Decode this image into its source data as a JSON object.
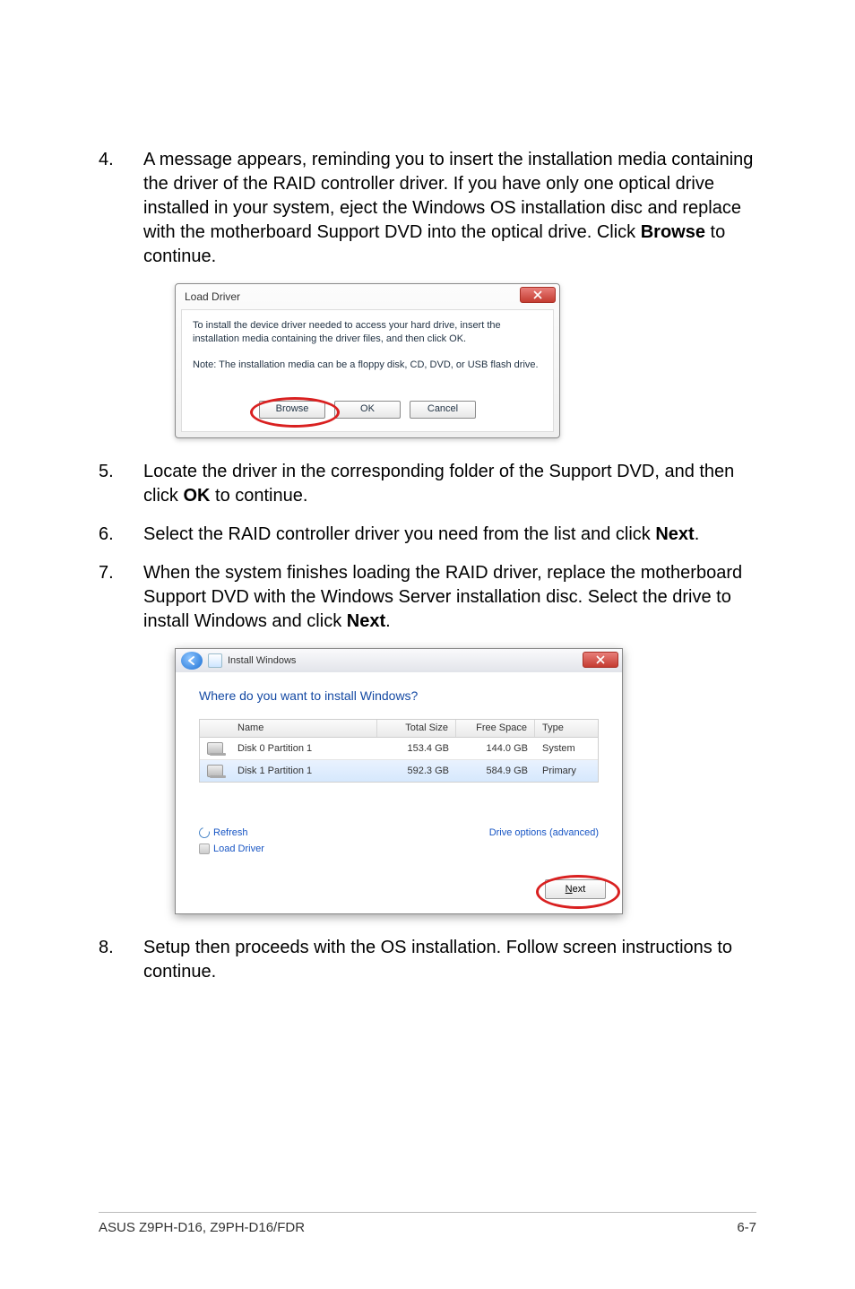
{
  "steps": {
    "s4": {
      "num": "4.",
      "text_a": "A message appears, reminding you to insert the installation media containing the driver of the RAID controller driver. If you have only one optical drive installed in your system, eject the Windows OS installation disc and replace with the motherboard Support DVD into the optical drive. Click ",
      "bold_a": "Browse",
      "text_b": " to continue."
    },
    "s5": {
      "num": "5.",
      "text_a": "Locate the driver in the corresponding folder of the Support DVD, and then click ",
      "bold_a": "OK",
      "text_b": " to continue."
    },
    "s6": {
      "num": "6.",
      "text_a": "Select the RAID controller driver you need from the list and click ",
      "bold_a": "Next",
      "text_b": "."
    },
    "s7": {
      "num": "7.",
      "text_a": "When the system finishes loading the RAID driver, replace the motherboard Support DVD with the Windows Server installation disc. Select the drive to install Windows and click ",
      "bold_a": "Next",
      "text_b": "."
    },
    "s8": {
      "num": "8.",
      "text_a": "Setup then proceeds with the OS installation. Follow screen instructions to continue."
    }
  },
  "dlg1": {
    "title": "Load Driver",
    "p1": "To install the device driver needed to access your hard drive, insert the installation media containing the driver files, and then click OK.",
    "p2": "Note: The installation media can be a floppy disk, CD, DVD, or USB flash drive.",
    "btn_browse": "Browse",
    "btn_ok": "OK",
    "btn_cancel": "Cancel"
  },
  "dlg2": {
    "win_title": "Install Windows",
    "heading": "Where do you want to install Windows?",
    "headers": {
      "name": "Name",
      "total": "Total Size",
      "free": "Free Space",
      "type": "Type"
    },
    "rows": [
      {
        "name": "Disk 0 Partition 1",
        "total": "153.4 GB",
        "free": "144.0 GB",
        "type": "System"
      },
      {
        "name": "Disk 1 Partition 1",
        "total": "592.3 GB",
        "free": "584.9 GB",
        "type": "Primary"
      }
    ],
    "refresh": "Refresh",
    "load": "Load Driver",
    "adv": "Drive options (advanced)",
    "next": "Next"
  },
  "footer": {
    "left": "ASUS Z9PH-D16, Z9PH-D16/FDR",
    "right": "6-7"
  }
}
